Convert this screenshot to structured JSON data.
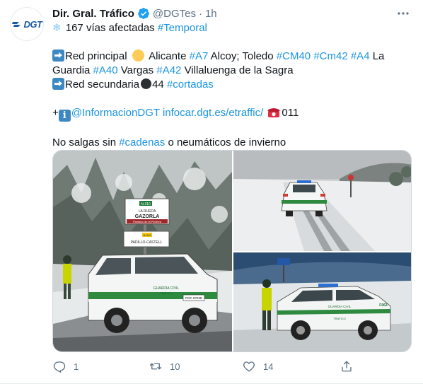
{
  "tweet": {
    "author": {
      "name": "Dir. Gral. Tráfico",
      "handle": "@DGTes",
      "time": "1h",
      "separator": "·",
      "avatar_logo_text": "DGT"
    },
    "text": {
      "line1": {
        "count": "167 vías afectadas",
        "hashtag": "#Temporal"
      },
      "line2": {
        "label": "Red principal",
        "place1": "Alicante",
        "tag1": "#A7",
        "place2": "Alcoy; Toledo",
        "tag2": "#CM40",
        "tag3": "#Cm42",
        "tag4": "#A4",
        "place3": "La Guardia",
        "tag5": "#A40",
        "place4": "Vargas",
        "tag6": "#A42",
        "place5": "Villaluenga de la Sagra"
      },
      "line3": {
        "label": "Red secundaria",
        "count": "44",
        "hashtag": "#cortadas"
      },
      "line4": {
        "prefix": "+",
        "info_glyph": "i",
        "mention": "@InformacionDGT",
        "link": "infocar.dgt.es/etraffic/",
        "phone_number": "011"
      },
      "line5": {
        "before": "No salgas sin",
        "hashtag": "#cadenas",
        "after": "o neumáticos de invierno"
      }
    },
    "media": {
      "photo1": {
        "sign_top": "N-310",
        "sign_line1": "LA RUEDA",
        "sign_line2": "GAZORLA",
        "sign_line3": "Pantano de la Pedrera",
        "sign_bottom_top": "N-310",
        "sign_bottom": "PADILLO-CASTELL",
        "car_text1": "GUARDIA CIVIL",
        "car_text2": "TRÁFICO",
        "plate": "PGC 8762E"
      },
      "photo3": {
        "car_text": "GUARDIA CIVIL",
        "car_text2": "TRÁFICO",
        "car_id": "F063"
      }
    },
    "actions": {
      "reply_count": "1",
      "retweet_count": "10",
      "like_count": "14"
    },
    "colors": {
      "link": "#1b95e0",
      "muted": "#5b7083",
      "text": "#0f1419",
      "verified": "#1da1f2"
    },
    "icons": [
      "dgt-logo-icon",
      "verified-badge-icon",
      "more-icon",
      "snowflake-icon",
      "arrow-right-icon",
      "yellow-circle-icon",
      "black-circle-icon",
      "info-icon",
      "telephone-icon",
      "reply-icon",
      "retweet-icon",
      "like-icon",
      "share-icon"
    ]
  }
}
